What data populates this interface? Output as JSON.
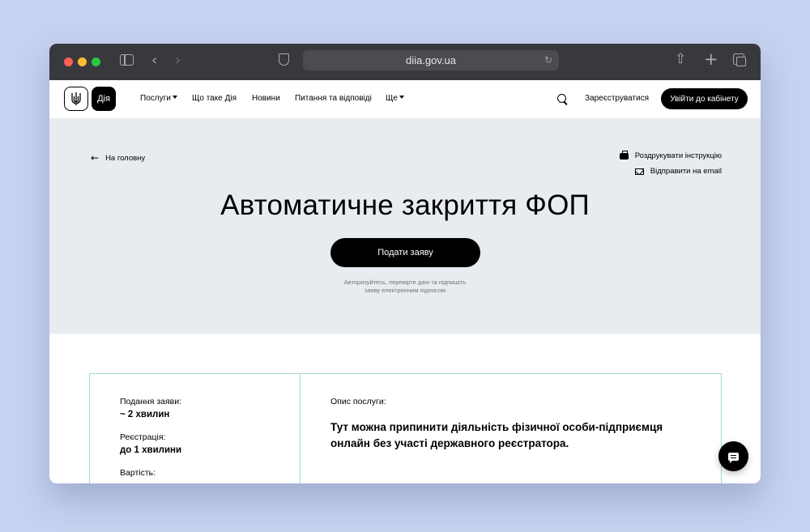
{
  "browser": {
    "url": "diia.gov.ua"
  },
  "header": {
    "logo_text": "Дія",
    "nav": [
      {
        "label": "Послуги",
        "dropdown": true
      },
      {
        "label": "Що таке Дія",
        "dropdown": false
      },
      {
        "label": "Новини",
        "dropdown": false
      },
      {
        "label": "Питання та відповіді",
        "dropdown": false
      },
      {
        "label": "Ще",
        "dropdown": true
      }
    ],
    "register_label": "Зареєструватися",
    "login_label": "Увійти до кабінету"
  },
  "hero": {
    "back_label": "На головну",
    "print_label": "Роздрукувати інструкцію",
    "email_label": "Відправити на email",
    "title": "Автоматичне закриття ФОП",
    "submit_label": "Подати заяву",
    "hint_line1": "Авторизуйтесь, перевірте дані та підпишіть",
    "hint_line2": "заяву електронним підписом"
  },
  "info": {
    "submission_label": "Подання заяви:",
    "submission_value": "~ 2 хвилин",
    "registration_label": "Реєстрація:",
    "registration_value": "до 1 хвилини",
    "cost_label": "Вартість:",
    "description_label": "Опис послуги:",
    "description_text": "Тут можна припинити діяльність фізичної особи-підприємця онлайн без участі державного реєстратора."
  },
  "colors": {
    "page_background": "#c6d2ef",
    "chrome": "#37393d",
    "hero_background": "#e8ebf0",
    "accent": "#000000",
    "card_border": "#a6d7d4"
  }
}
